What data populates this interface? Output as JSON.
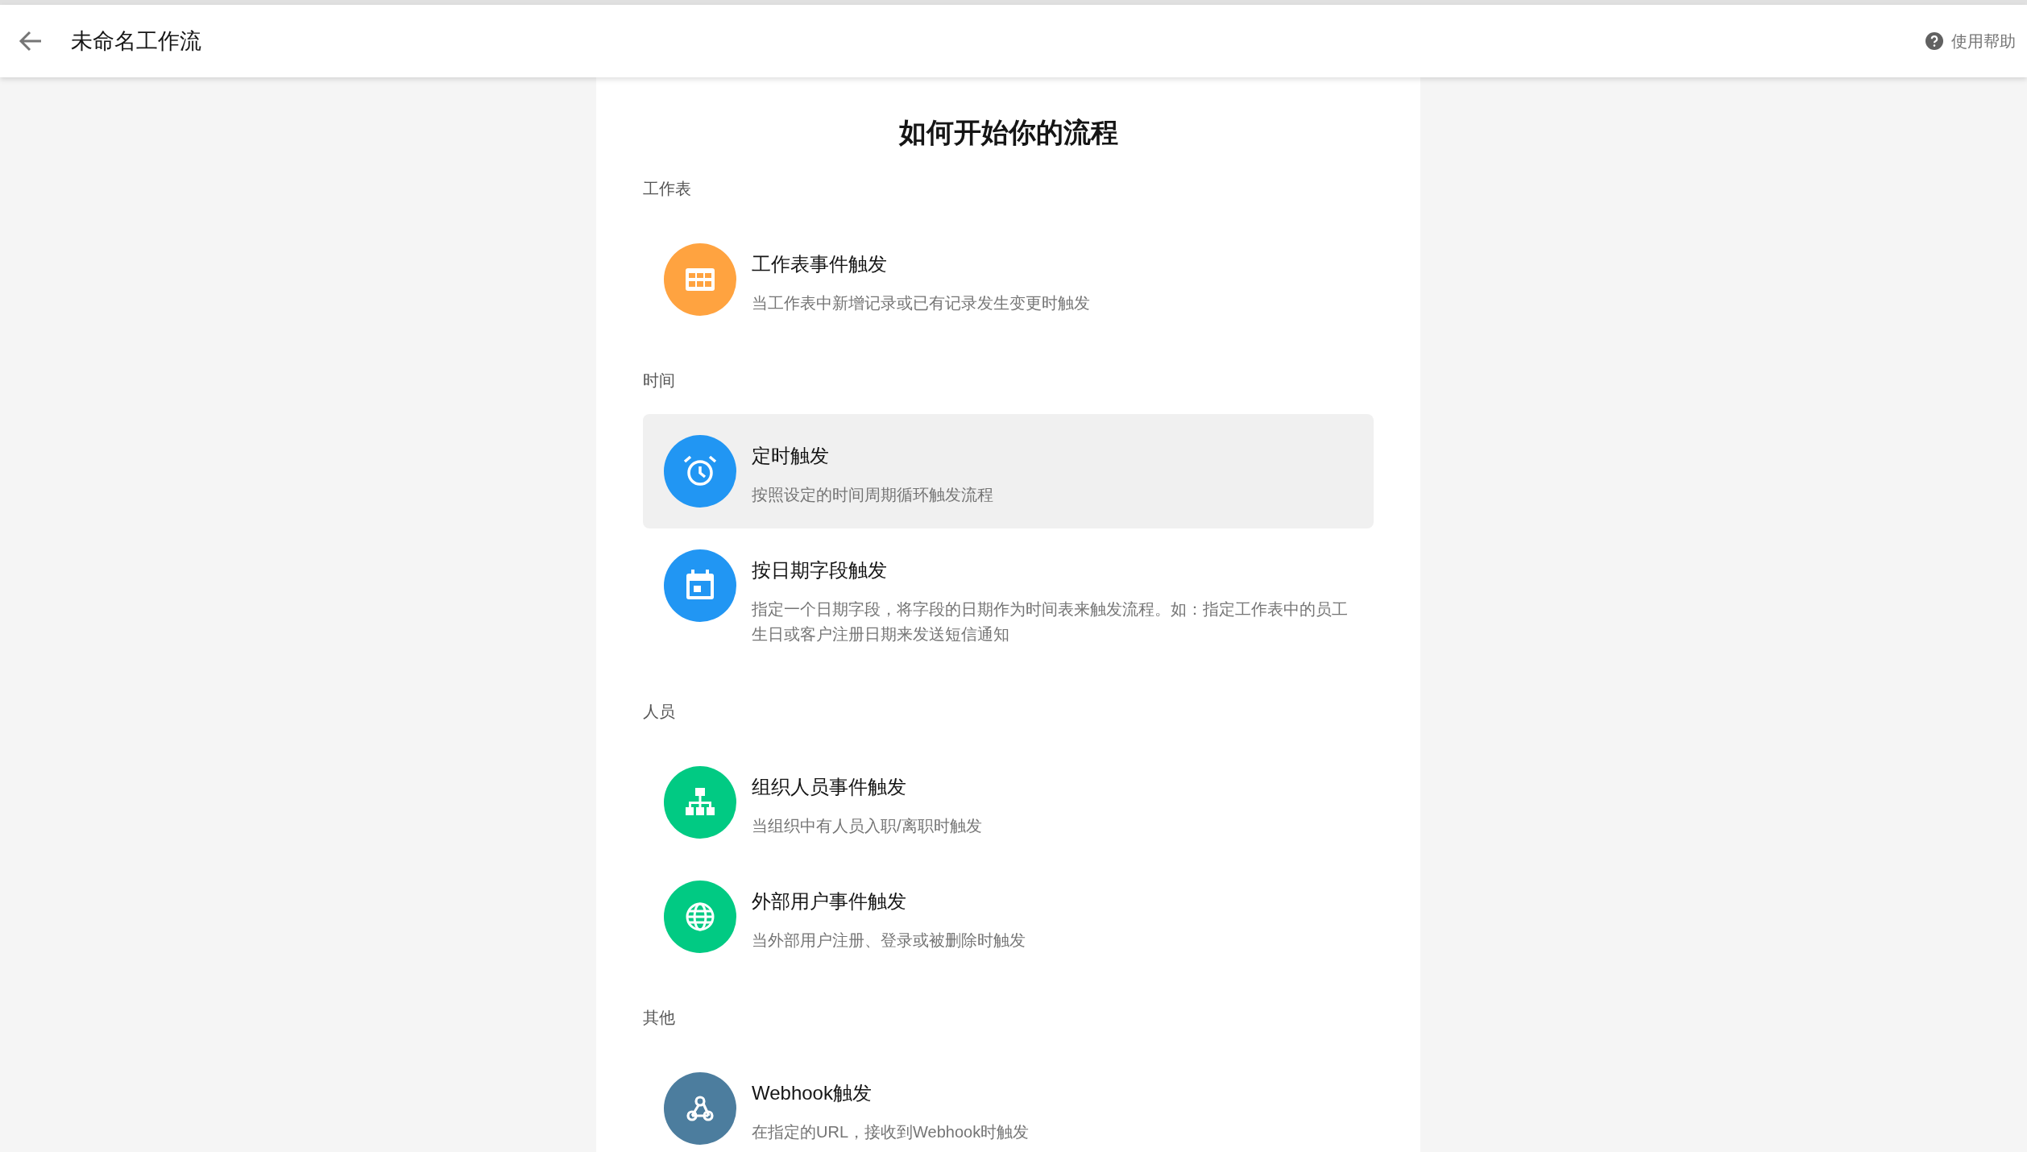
{
  "header": {
    "title": "未命名工作流",
    "help": "使用帮助"
  },
  "heading": "如何开始你的流程",
  "sections": [
    {
      "label": "工作表",
      "items": [
        {
          "kind": "table",
          "color": "#ffa340",
          "title": "工作表事件触发",
          "description": "当工作表中新增记录或已有记录发生变更时触发",
          "selected": false
        }
      ]
    },
    {
      "label": "时间",
      "items": [
        {
          "kind": "alarm",
          "color": "#2196f3",
          "title": "定时触发",
          "description": "按照设定的时间周期循环触发流程",
          "selected": true
        },
        {
          "kind": "calendar",
          "color": "#2196f3",
          "title": "按日期字段触发",
          "description": "指定一个日期字段，将字段的日期作为时间表来触发流程。如：指定工作表中的员工生日或客户注册日期来发送短信通知",
          "selected": false
        }
      ]
    },
    {
      "label": "人员",
      "items": [
        {
          "kind": "org",
          "color": "#01ca83",
          "title": "组织人员事件触发",
          "description": "当组织中有人员入职/离职时触发",
          "selected": false
        },
        {
          "kind": "globe",
          "color": "#01ca83",
          "title": "外部用户事件触发",
          "description": "当外部用户注册、登录或被删除时触发",
          "selected": false
        }
      ]
    },
    {
      "label": "其他",
      "items": [
        {
          "kind": "webhook",
          "color": "#4c7d9e",
          "title": "Webhook触发",
          "description": "在指定的URL，接收到Webhook时触发",
          "selected": false
        }
      ]
    }
  ]
}
